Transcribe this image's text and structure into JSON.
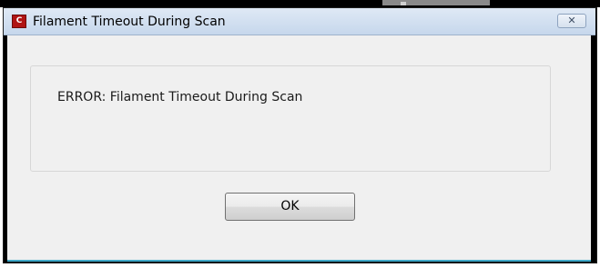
{
  "window": {
    "title": "Filament Timeout During Scan",
    "app_icon_text": "C",
    "close_glyph": "✕"
  },
  "dialog": {
    "message": "ERROR: Filament Timeout During Scan",
    "ok_label": "OK"
  },
  "colors": {
    "titlebar": "#c6d7ec",
    "client": "#f0f0f0",
    "app_icon": "#b01414",
    "bottom_accent": "#3fa9c9"
  },
  "icons": {
    "app": "app-logo-icon",
    "close": "close-icon"
  }
}
